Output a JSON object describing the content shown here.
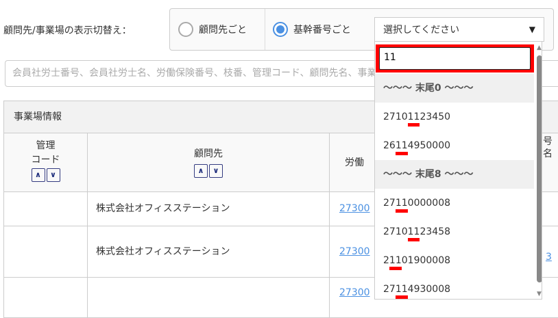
{
  "toggle": {
    "label": "顧問先/事業場の表示切替え：",
    "options": [
      {
        "label": "顧問先ごと",
        "selected": false
      },
      {
        "label": "基幹番号ごと",
        "selected": true
      }
    ]
  },
  "select": {
    "placeholder": "選択してください",
    "arrow": "▼"
  },
  "search": {
    "placeholder": "会員社労士番号、会員社労士名、労働保険番号、枝番、管理コード、顧問先名、事業場名、基幹番号"
  },
  "table": {
    "section_title": "事業場情報",
    "headers": {
      "code": [
        "管理",
        "コード"
      ],
      "client": "顧問先",
      "insurance": "労働",
      "right": [
        "号",
        "名"
      ]
    },
    "rows": [
      {
        "client": "株式会社オフィスステーション",
        "insurance": "27300"
      },
      {
        "client": "株式会社オフィスステーション",
        "insurance": "27300",
        "right": "3"
      },
      {
        "client": "",
        "insurance": "27300"
      }
    ]
  },
  "dropdown": {
    "filter_value": "11",
    "groups": [
      {
        "label": "〜〜〜 末尾0 〜〜〜",
        "items": [
          {
            "pre": "2710",
            "match": "11",
            "post": "23450"
          },
          {
            "pre": "26",
            "match": "11",
            "post": "4950000"
          }
        ]
      },
      {
        "label": "〜〜〜 末尾8 〜〜〜",
        "items": [
          {
            "pre": "27",
            "match": "11",
            "post": "0000008"
          },
          {
            "pre": "2710",
            "match": "11",
            "post": "23458"
          },
          {
            "pre": "2",
            "match": "11",
            "post": "01900008"
          },
          {
            "pre": "27",
            "match": "11",
            "post": "4930008"
          }
        ]
      }
    ],
    "highlight_color": "#ff0000"
  },
  "sort": {
    "up": "︿",
    "down": "﹀"
  }
}
